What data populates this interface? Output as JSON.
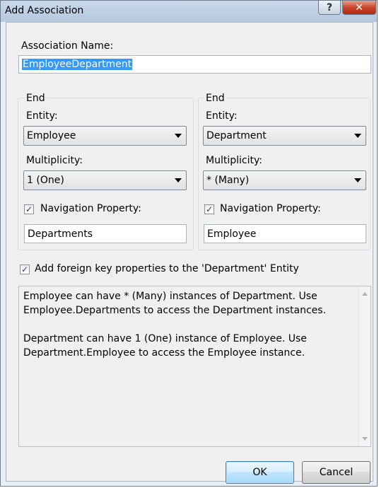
{
  "window": {
    "title": "Add Association",
    "help_glyph": "?",
    "close_glyph": "✕"
  },
  "association": {
    "label": "Association Name:",
    "value": "EmployeeDepartment"
  },
  "end1": {
    "group_label": "End",
    "entity_label": "Entity:",
    "entity_value": "Employee",
    "multiplicity_label": "Multiplicity:",
    "multiplicity_value": "1 (One)",
    "nav_checked": true,
    "nav_label": "Navigation Property:",
    "nav_value": "Departments"
  },
  "end2": {
    "group_label": "End",
    "entity_label": "Entity:",
    "entity_value": "Department",
    "multiplicity_label": "Multiplicity:",
    "multiplicity_value": "* (Many)",
    "nav_checked": true,
    "nav_label": "Navigation Property:",
    "nav_value": "Employee"
  },
  "foreign_key": {
    "checked": true,
    "label": "Add foreign key properties to the 'Department' Entity"
  },
  "description": {
    "para1": "Employee can have * (Many) instances of Department. Use Employee.Departments to access the Department instances.",
    "para2": "Department can have 1 (One) instance of Employee. Use Department.Employee to access the Employee instance."
  },
  "buttons": {
    "ok": "OK",
    "cancel": "Cancel"
  },
  "icons": {
    "check": "✓",
    "combo_arrow": "chevron-down-icon"
  }
}
